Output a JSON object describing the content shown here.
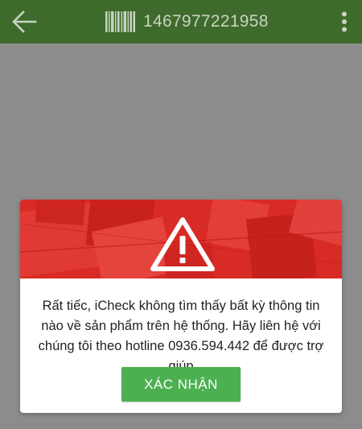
{
  "appbar": {
    "title": "1467977221958",
    "back_icon": "arrow-left-icon",
    "barcode_icon": "barcode-icon",
    "menu_icon": "more-vert-icon"
  },
  "dialog": {
    "banner_icon": "warning-triangle-icon",
    "message": "Rất tiếc, iCheck không tìm thấy bất kỳ thông tin nào về sản phẩm trên hệ thống. Hãy liên hệ với chúng tôi theo hotline 0936.594.442 để được trợ giúp",
    "confirm_label": "XÁC NHẬN"
  },
  "colors": {
    "appbar": "#3e6b2b",
    "overlay": "#8c8c8c",
    "banner": "#d92b25",
    "confirm_button": "#4caf50"
  }
}
